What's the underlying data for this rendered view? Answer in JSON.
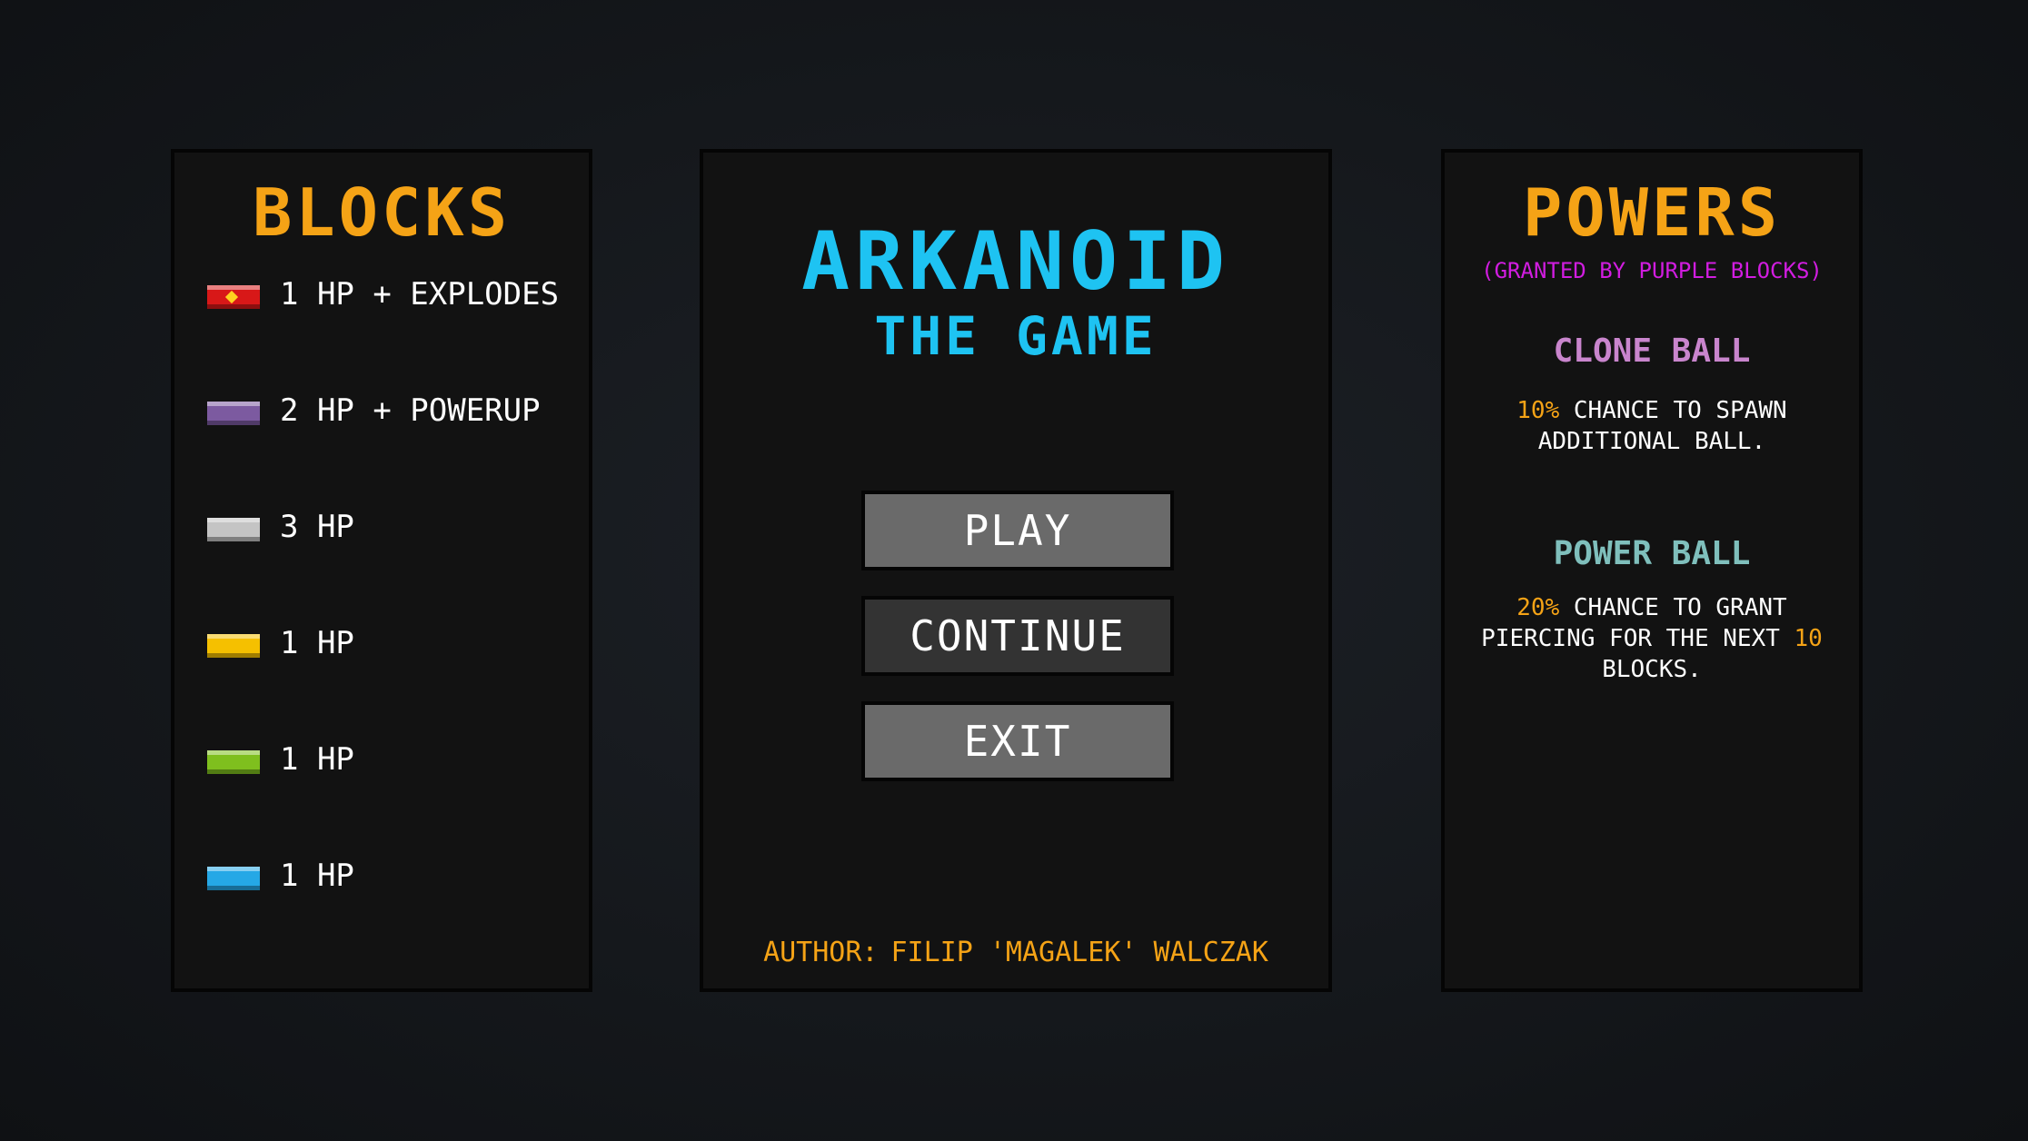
{
  "blocks": {
    "title": "BLOCKS",
    "items": [
      {
        "label": "1 HP + EXPLODES",
        "color": "#d81818",
        "icon": "explosive-block-icon"
      },
      {
        "label": "2 HP + POWERUP",
        "color": "#7c5aa0",
        "icon": "powerup-block-icon"
      },
      {
        "label": "3 HP",
        "color": "#c4c4c4",
        "icon": "silver-block-icon"
      },
      {
        "label": "1 HP",
        "color": "#f5c000",
        "icon": "yellow-block-icon"
      },
      {
        "label": "1 HP",
        "color": "#7fbf1e",
        "icon": "green-block-icon"
      },
      {
        "label": "1 HP",
        "color": "#25a8e6",
        "icon": "blue-block-icon"
      }
    ]
  },
  "menu": {
    "title": "ARKANOID",
    "subtitle": "THE GAME",
    "play_label": "PLAY",
    "continue_label": "CONTINUE",
    "exit_label": "EXIT",
    "author_label": "AUTHOR:",
    "author_name": "FILIP 'MAGALEK' WALCZAK"
  },
  "powers": {
    "title": "POWERS",
    "subtitle": "(GRANTED BY PURPLE BLOCKS)",
    "clone_ball": {
      "name": "CLONE BALL",
      "chance": "10%",
      "desc_1": " CHANCE TO SPAWN",
      "desc_2": "ADDITIONAL BALL."
    },
    "power_ball": {
      "name": "POWER BALL",
      "chance": "20%",
      "desc_1": " CHANCE TO GRANT",
      "desc_2": "PIERCING FOR THE NEXT ",
      "count": "10",
      "desc_3": "BLOCKS."
    }
  },
  "colors": {
    "accent_orange": "#f5a316",
    "title_cyan": "#1ec3f2",
    "purple_subtitle": "#d11de0",
    "clone_ball": "#c985cd",
    "power_ball": "#7fbfbc"
  }
}
